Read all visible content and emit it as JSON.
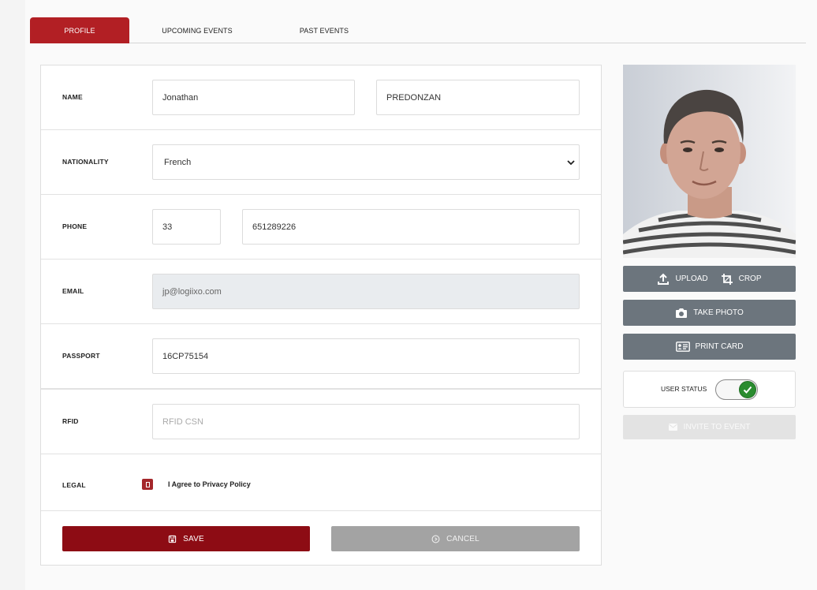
{
  "tabs": [
    {
      "label": "PROFILE",
      "active": true
    },
    {
      "label": "UPCOMING EVENTS",
      "active": false
    },
    {
      "label": "PAST EVENTS",
      "active": false
    }
  ],
  "form": {
    "name": {
      "label": "NAME",
      "first": "Jonathan",
      "last": "PREDONZAN"
    },
    "nationality": {
      "label": "NATIONALITY",
      "value": "French"
    },
    "phone": {
      "label": "PHONE",
      "country_code": "33",
      "number": "651289226"
    },
    "email": {
      "label": "EMAIL",
      "value": "jp@logiixo.com"
    },
    "passport": {
      "label": "PASSPORT",
      "value": "16CP75154"
    },
    "rfid": {
      "label": "RFID",
      "placeholder": "RFID CSN"
    },
    "legal": {
      "label": "LEGAL",
      "checkbox_label": "I Agree to Privacy Policy",
      "checked": true
    }
  },
  "actions": {
    "save": "SAVE",
    "cancel": "CANCEL"
  },
  "sidebar": {
    "upload": "UPLOAD",
    "crop": "CROP",
    "take_photo": "TAKE PHOTO",
    "print_card": "PRINT CARD",
    "user_status_label": "USER STATUS",
    "user_status_on": true,
    "invite": "INVITE TO EVENT"
  },
  "colors": {
    "brand": "#b21f24",
    "save": "#8d0c14",
    "secondary": "#6c757d",
    "status_on": "#2a8c2f"
  },
  "icons": [
    "chevron-down-icon",
    "upload-icon",
    "crop-icon",
    "camera-icon",
    "id-card-icon",
    "check-icon",
    "envelope-icon",
    "save-icon",
    "cancel-icon"
  ]
}
